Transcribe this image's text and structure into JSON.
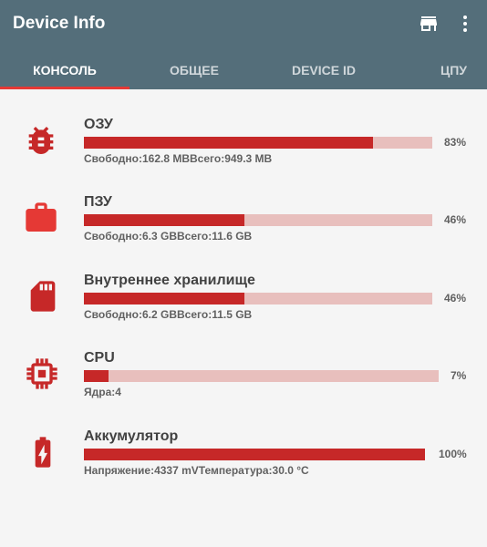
{
  "app": {
    "title": "Device Info"
  },
  "icons": {
    "store": "store-icon",
    "menu": "more-vert-icon",
    "accent": "#c62828"
  },
  "colors": {
    "appbar": "#546e7a",
    "bar_fill": "#c62828",
    "bar_track": "#e8bfbd",
    "tab_indicator": "#e53935"
  },
  "tabs": [
    {
      "label": "Консоль",
      "active": true
    },
    {
      "label": "Общее",
      "active": false
    },
    {
      "label": "Device ID",
      "active": false
    },
    {
      "label": "ЦПУ",
      "active": false
    }
  ],
  "rows": [
    {
      "title": "ОЗУ",
      "percent_label": "83%",
      "progress": 0.83,
      "info": [
        "Свободно:162.8 MB",
        "Всего:949.3 MB"
      ],
      "icon": "bug-icon"
    },
    {
      "title": "ПЗУ",
      "percent_label": "46%",
      "progress": 0.46,
      "info": [
        "Свободно:6.3 GB",
        "Всего:11.6 GB"
      ],
      "icon": "briefcase-icon"
    },
    {
      "title": "Внутреннее хранилище",
      "percent_label": "46%",
      "progress": 0.46,
      "info": [
        "Свободно:6.2 GB",
        "Всего:11.5 GB"
      ],
      "icon": "sd-card-icon"
    },
    {
      "title": "CPU",
      "percent_label": "7%",
      "progress": 0.07,
      "info": [
        "Ядра:4"
      ],
      "icon": "chip-icon"
    },
    {
      "title": "Аккумулятор",
      "percent_label": "100%",
      "progress": 1.0,
      "info": [
        "Напряжение:4337 mV",
        "Температура:30.0 °C"
      ],
      "icon": "battery-charging-icon"
    }
  ]
}
